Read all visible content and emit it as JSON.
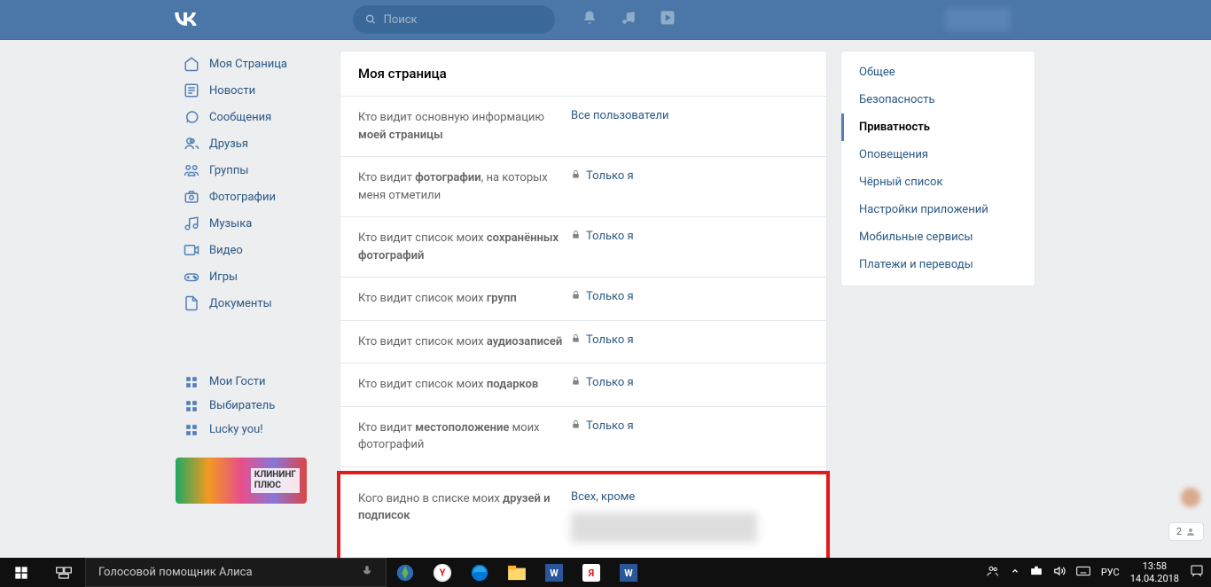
{
  "header": {
    "logo": "VK",
    "search_placeholder": "Поиск"
  },
  "sidebar": {
    "items": [
      {
        "label": "Моя Страница",
        "icon": "home"
      },
      {
        "label": "Новости",
        "icon": "news"
      },
      {
        "label": "Сообщения",
        "icon": "messages"
      },
      {
        "label": "Друзья",
        "icon": "friends"
      },
      {
        "label": "Группы",
        "icon": "groups"
      },
      {
        "label": "Фотографии",
        "icon": "photos"
      },
      {
        "label": "Музыка",
        "icon": "music"
      },
      {
        "label": "Видео",
        "icon": "video"
      },
      {
        "label": "Игры",
        "icon": "games"
      },
      {
        "label": "Документы",
        "icon": "docs"
      }
    ],
    "extra": [
      {
        "label": "Мои Гости"
      },
      {
        "label": "Выбиратель"
      },
      {
        "label": "Lucky you!"
      }
    ],
    "ad_text": "КЛИНИНГ\nПЛЮС"
  },
  "main": {
    "title": "Моя страница",
    "rows": [
      {
        "label_pre": "Кто видит основную информацию ",
        "label_bold": "моей страницы",
        "value": "Все пользователи",
        "locked": false
      },
      {
        "label_pre": "Кто видит ",
        "label_bold": "фотографии",
        "label_post": ", на которых меня отметили",
        "value": "Только я",
        "locked": true
      },
      {
        "label_pre": "Кто видит список моих ",
        "label_bold": "сохранённых фотографий",
        "value": "Только я",
        "locked": true
      },
      {
        "label_pre": "Кто видит список моих ",
        "label_bold": "групп",
        "value": "Только я",
        "locked": true
      },
      {
        "label_pre": "Кто видит список моих ",
        "label_bold": "аудиозаписей",
        "value": "Только я",
        "locked": true
      },
      {
        "label_pre": "Кто видит список моих ",
        "label_bold": "подарков",
        "value": "Только я",
        "locked": true
      },
      {
        "label_pre": "Кто видит ",
        "label_bold": "местоположение",
        "label_post": " моих фотографий",
        "value": "Только я",
        "locked": true
      },
      {
        "label_pre": "Кого видно в списке моих ",
        "label_bold": "друзей и подписок",
        "value": "Всех, кроме",
        "locked": false,
        "highlight": true
      }
    ]
  },
  "settings": {
    "items": [
      {
        "label": "Общее"
      },
      {
        "label": "Безопасность"
      },
      {
        "label": "Приватность",
        "active": true
      },
      {
        "label": "Оповещения"
      },
      {
        "label": "Чёрный список"
      },
      {
        "label": "Настройки приложений"
      },
      {
        "label": "Мобильные сервисы"
      },
      {
        "label": "Платежи и переводы"
      }
    ]
  },
  "float_counter": "2",
  "taskbar": {
    "alice": "Голосовой помощник Алиса",
    "lang": "РУС",
    "time": "13:58",
    "date": "14.04.2018"
  }
}
